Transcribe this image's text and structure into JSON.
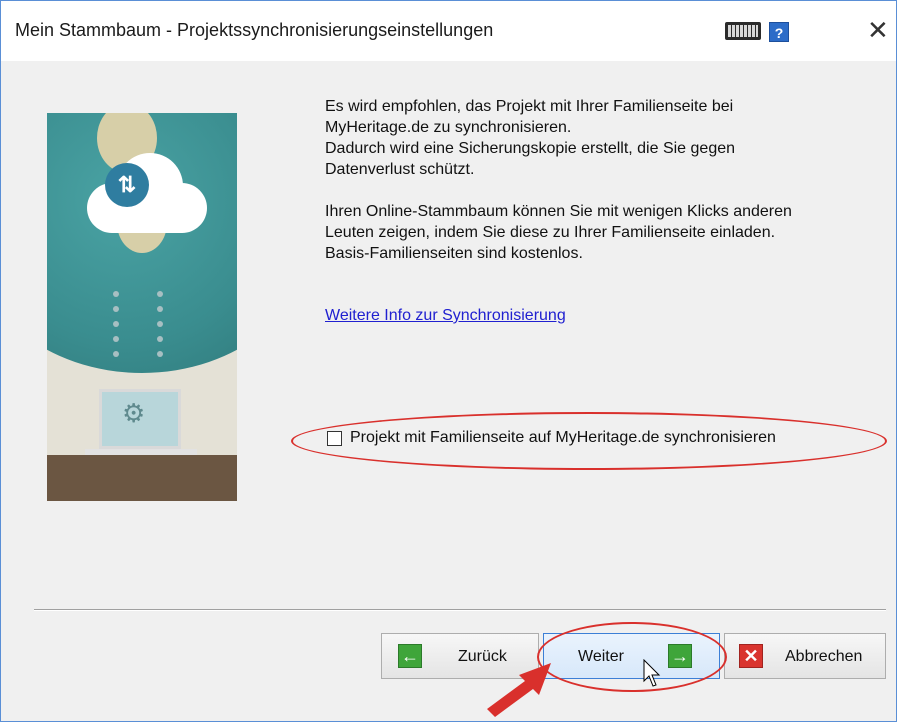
{
  "window": {
    "title": "Mein Stammbaum - Projektssynchronisierungseinstellungen",
    "help_label": "?",
    "close_label": "✕"
  },
  "illustration": {
    "icons": [
      "globe",
      "cloud-sync-icon",
      "laptop-icon",
      "gears-icon"
    ]
  },
  "content": {
    "paragraph1_line1": "Es wird empfohlen, das Projekt mit Ihrer Familienseite bei",
    "paragraph1_line2": "MyHeritage.de zu synchronisieren.",
    "paragraph1_line3": "Dadurch wird eine Sicherungskopie erstellt, die Sie gegen",
    "paragraph1_line4": "Datenverlust schützt.",
    "paragraph2_line1": "Ihren Online-Stammbaum können Sie mit wenigen Klicks anderen",
    "paragraph2_line2": "Leuten zeigen, indem Sie diese zu Ihrer Familienseite einladen.",
    "paragraph2_line3": "Basis-Familienseiten sind kostenlos.",
    "link_text": "Weitere Info zur Synchronisierung",
    "checkbox_label": "Projekt mit Familienseite auf MyHeritage.de synchronisieren",
    "checkbox_checked": false
  },
  "buttons": {
    "back_label": "Zurück",
    "back_icon": "←",
    "next_label": "Weiter",
    "next_icon": "→",
    "cancel_label": "Abbrechen",
    "cancel_icon": "✕"
  },
  "colors": {
    "annotation_red": "#d9302c",
    "link_blue": "#2020d0",
    "primary_button_border": "#3c7fd6"
  }
}
